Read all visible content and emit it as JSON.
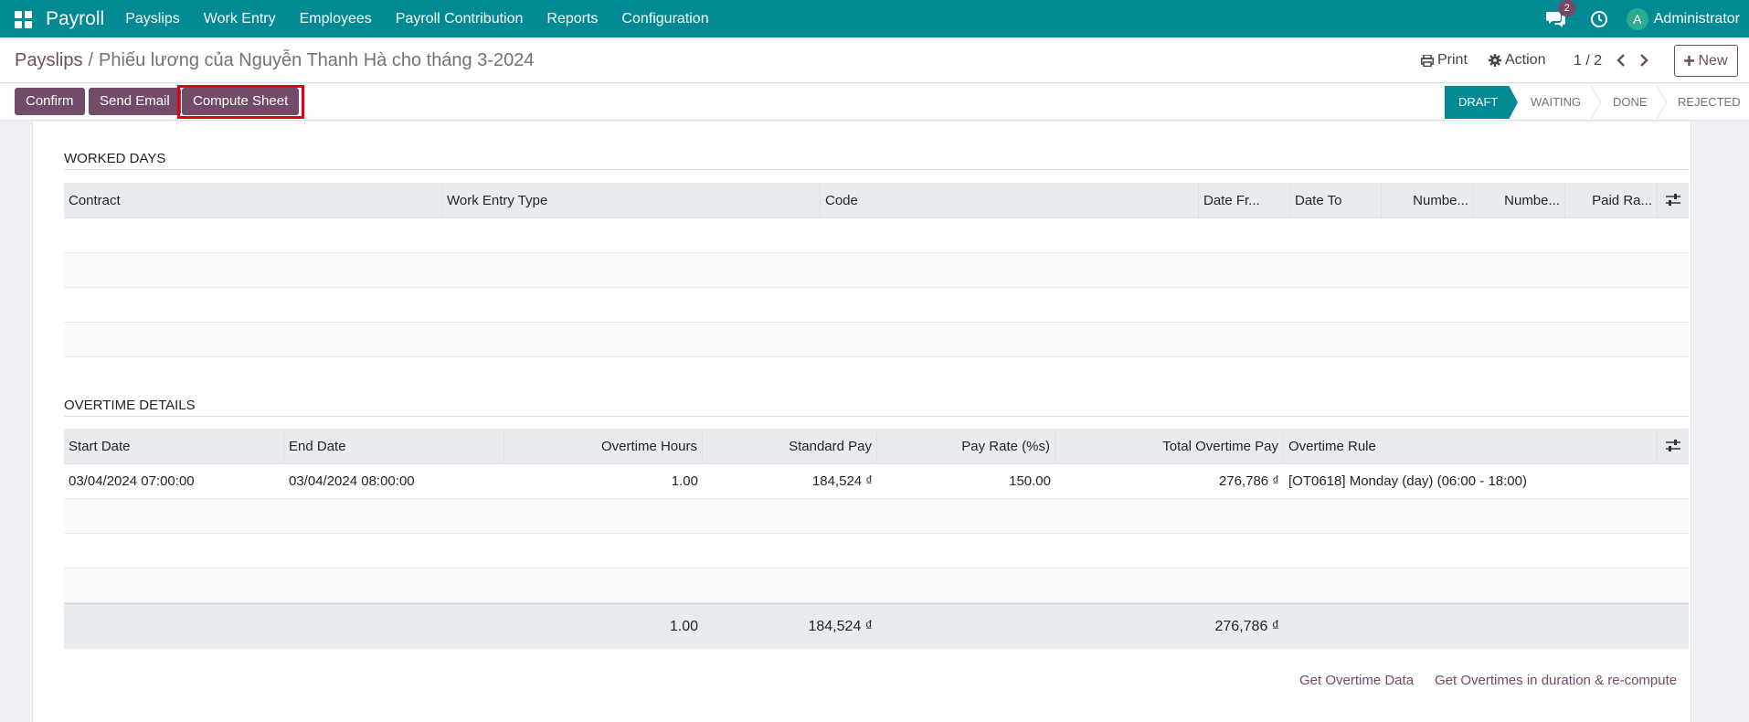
{
  "navbar": {
    "brand": "Payroll",
    "menu": [
      "Payslips",
      "Work Entry",
      "Employees",
      "Payroll Contribution",
      "Reports",
      "Configuration"
    ],
    "chat_count": "2",
    "avatar_initial": "A",
    "user": "Administrator"
  },
  "control": {
    "breadcrumb_parent": "Payslips",
    "breadcrumb_sep": "/",
    "breadcrumb_current": "Phiếu lương của Nguyễn Thanh Hà cho tháng 3-2024",
    "print": "Print",
    "action": "Action",
    "pager": "1 / 2",
    "new": "New"
  },
  "statusbar": {
    "buttons": [
      "Confirm",
      "Send Email",
      "Compute Sheet"
    ],
    "stages": [
      "Draft",
      "Waiting",
      "Done",
      "Rejected"
    ],
    "active_stage": "Draft"
  },
  "worked_days": {
    "title": "Worked Days",
    "columns": [
      "Contract",
      "Work Entry Type",
      "Code",
      "Date Fr...",
      "Date To",
      "Numbe...",
      "Numbe...",
      "Paid Ra..."
    ]
  },
  "overtime": {
    "title": "Overtime Details",
    "columns": [
      "Start Date",
      "End Date",
      "Overtime Hours",
      "Standard Pay",
      "Pay Rate (%s)",
      "Total Overtime Pay",
      "Overtime Rule"
    ],
    "rows": [
      {
        "start": "03/04/2024 07:00:00",
        "end": "03/04/2024 08:00:00",
        "hours": "1.00",
        "standard_pay": "184,524 ₫",
        "pay_rate": "150.00",
        "total_pay": "276,786 ₫",
        "rule": "[OT0618] Monday (day) (06:00 - 18:00)"
      }
    ],
    "totals": {
      "hours": "1.00",
      "standard_pay": "184,524 ₫",
      "total_pay": "276,786 ₫"
    }
  },
  "links": {
    "get_overtime": "Get Overtime Data",
    "recompute": "Get Overtimes in duration & re-compute"
  },
  "colors": {
    "navbar": "#018a93",
    "primary": "#714b67",
    "highlight": "#e3000f"
  }
}
